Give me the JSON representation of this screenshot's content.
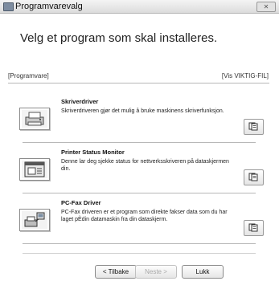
{
  "window": {
    "title": "Programvarevalg",
    "close_label": "✕"
  },
  "header": {
    "headline": "Velg et program som skal installeres."
  },
  "section": {
    "label": "[Programvare]",
    "readme_link": "[Vis VIKTIG-FIL]"
  },
  "items": [
    {
      "title": "Skriverdriver",
      "description": "Skriverdriveren gjør det mulig å bruke maskinens skriverfunksjon.",
      "icon": "printer-icon"
    },
    {
      "title": "Printer Status Monitor",
      "description": "Denne lar deg sjekke status for nettverksskriveren på dataskjermen din.",
      "icon": "status-monitor-icon"
    },
    {
      "title": "PC-Fax Driver",
      "description": "PC-Fax driveren er et program som direkte fakser data som du har laget pÈdin datamaskin fra din dataskjerm.",
      "icon": "fax-icon"
    }
  ],
  "footer": {
    "back_label": "< Tilbake",
    "next_label": "Neste >",
    "close_label": "Lukk"
  }
}
